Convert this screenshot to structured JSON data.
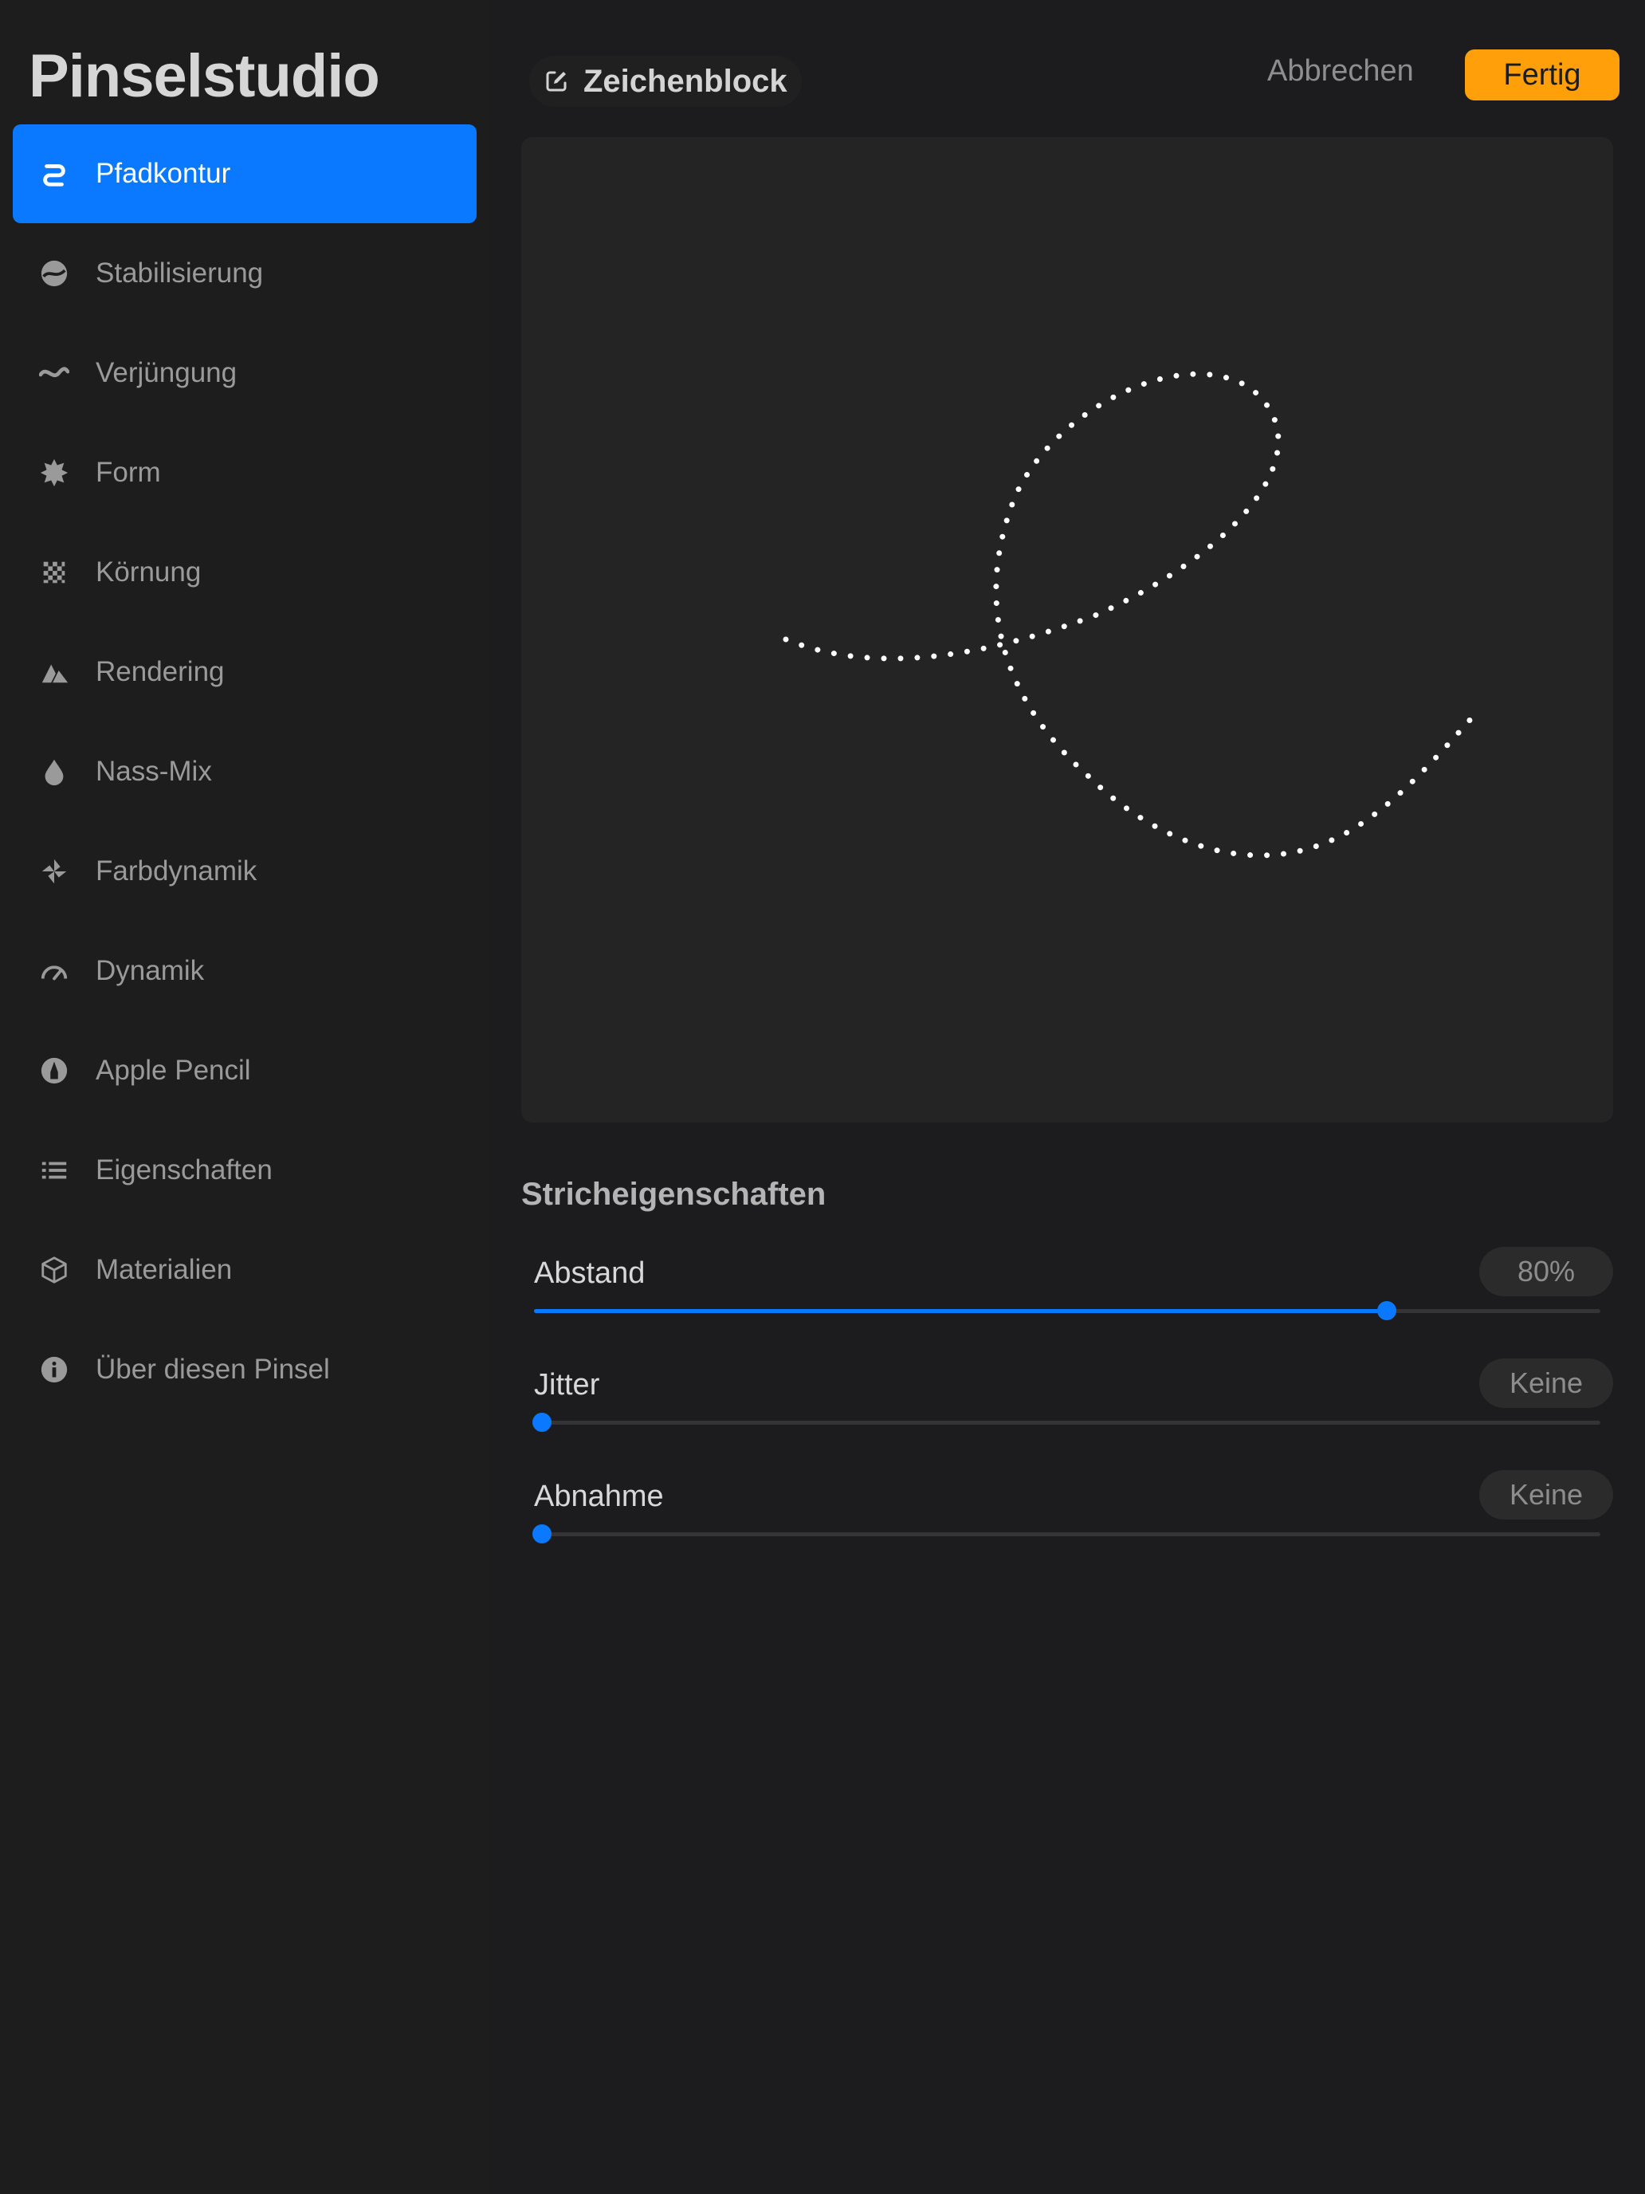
{
  "app_title": "Pinselstudio",
  "sidebar": {
    "items": [
      {
        "label": "Pfadkontur",
        "icon": "stroke-path-icon",
        "active": true
      },
      {
        "label": "Stabilisierung",
        "icon": "stabilization-icon"
      },
      {
        "label": "Verjüngung",
        "icon": "taper-icon"
      },
      {
        "label": "Form",
        "icon": "shape-icon"
      },
      {
        "label": "Körnung",
        "icon": "grain-icon"
      },
      {
        "label": "Rendering",
        "icon": "rendering-icon"
      },
      {
        "label": "Nass-Mix",
        "icon": "wet-mix-icon"
      },
      {
        "label": "Farbdynamik",
        "icon": "color-dynamics-icon"
      },
      {
        "label": "Dynamik",
        "icon": "dynamics-icon"
      },
      {
        "label": "Apple Pencil",
        "icon": "apple-pencil-icon"
      },
      {
        "label": "Eigenschaften",
        "icon": "properties-icon"
      },
      {
        "label": "Materialien",
        "icon": "materials-icon"
      },
      {
        "label": "Über diesen Pinsel",
        "icon": "info-icon"
      }
    ]
  },
  "header": {
    "drawing_pad": "Zeichenblock",
    "cancel": "Abbrechen",
    "done": "Fertig"
  },
  "colors": {
    "accent": "#0a78ff",
    "done_button": "#ff9f0a",
    "background": "#1c1c1e"
  },
  "stroke_properties": {
    "title": "Stricheigenschaften",
    "sliders": [
      {
        "label": "Abstand",
        "value_text": "80%",
        "value": 0.8
      },
      {
        "label": "Jitter",
        "value_text": "Keine",
        "value": 0
      },
      {
        "label": "Abnahme",
        "value_text": "Keine",
        "value": 0
      }
    ]
  }
}
